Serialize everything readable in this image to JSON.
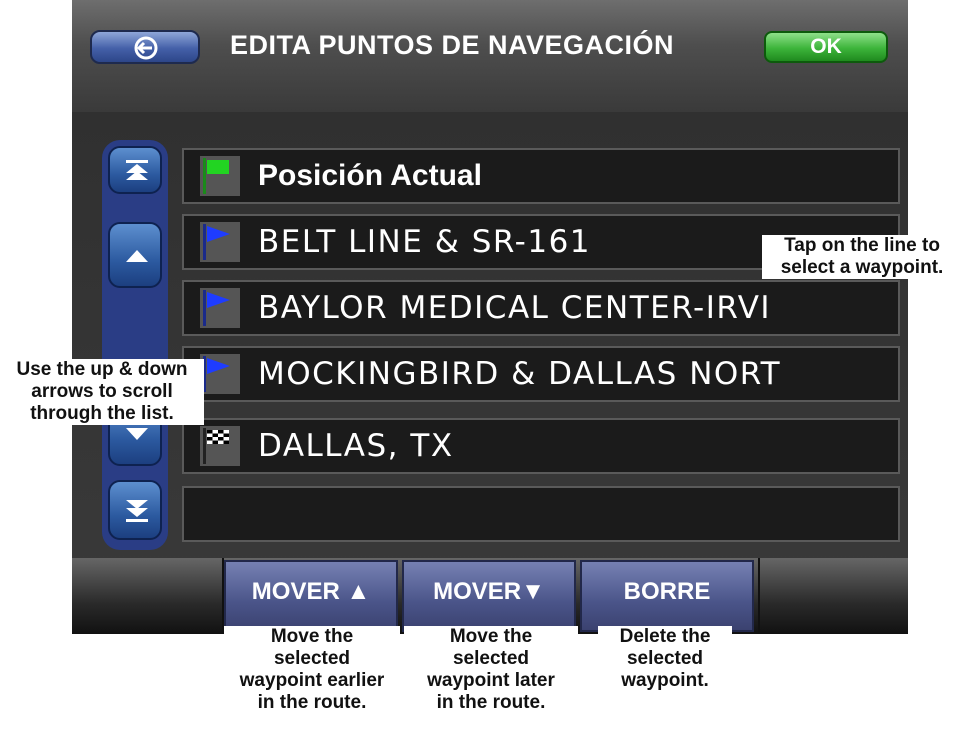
{
  "header": {
    "title": "EDITA PUNTOS DE NAVEGACIÓN",
    "back_icon": "back-arrow-icon",
    "ok_label": "OK"
  },
  "scroll": {
    "icons": [
      "scroll-to-top-icon",
      "scroll-up-icon",
      "scroll-down-icon",
      "scroll-to-bottom-icon"
    ]
  },
  "waypoints": [
    {
      "label": "Posición Actual",
      "flag": "green-flag-icon"
    },
    {
      "label": "BELT LINE & SR-161",
      "flag": "blue-flag-icon"
    },
    {
      "label": "BAYLOR MEDICAL CENTER-IRVI",
      "flag": "blue-flag-icon"
    },
    {
      "label": "MOCKINGBIRD & DALLAS NORT",
      "flag": "blue-flag-icon"
    },
    {
      "label": "DALLAS, TX",
      "flag": "checkered-flag-icon"
    }
  ],
  "bottom": {
    "move_up": "MOVER ▲",
    "move_down": "MOVER▼",
    "delete": "BORRE"
  },
  "annotations": {
    "tap": [
      "Tap on the line to",
      "select a waypoint."
    ],
    "scroll": [
      "Use the up & down",
      "arrows to scroll",
      "through the list."
    ],
    "move_up": [
      "Move the",
      "selected",
      "waypoint earlier",
      "in the route."
    ],
    "move_down": [
      "Move the",
      "selected",
      "waypoint later",
      "in the route."
    ],
    "delete": [
      "Delete the",
      "selected",
      "waypoint."
    ]
  },
  "colors": {
    "ok_green": "#3cb43a",
    "button_blue": "#2c5aa0",
    "flag_blue": "#1e3cff",
    "flag_green": "#22d422"
  }
}
